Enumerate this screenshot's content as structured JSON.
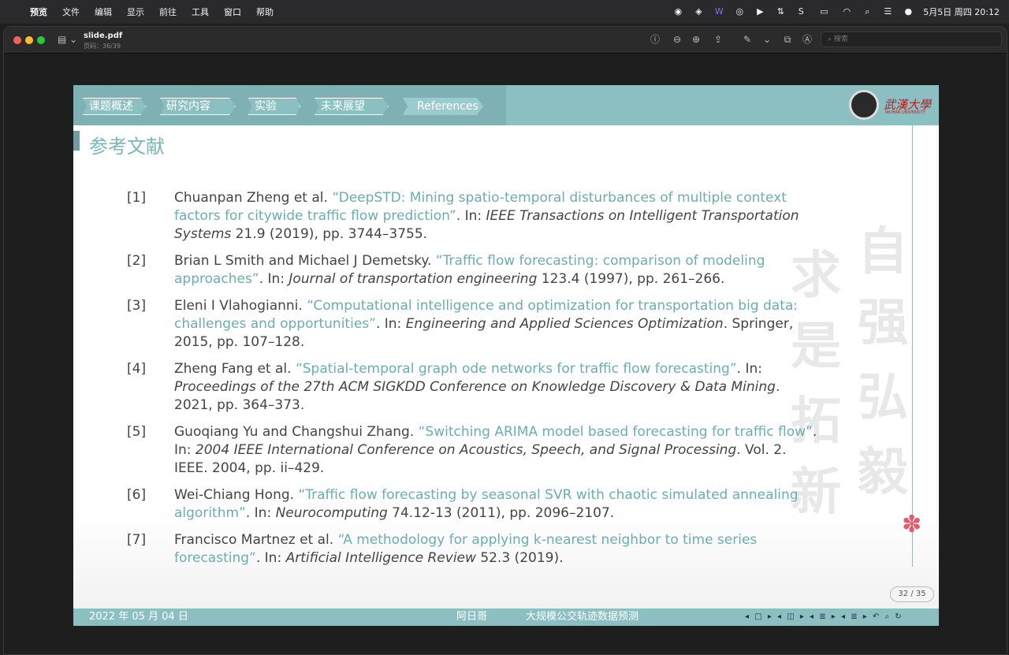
{
  "menubar": {
    "app": "预览",
    "items": [
      "文件",
      "编辑",
      "显示",
      "前往",
      "工具",
      "窗口",
      "帮助"
    ],
    "clock": "5月5日 周四  20:12"
  },
  "window": {
    "doc_title": "slide.pdf",
    "doc_subtitle": "页码：36/39",
    "search_placeholder": "搜索"
  },
  "slide": {
    "nav_tabs": [
      "课题概述",
      "研究内容",
      "实验",
      "未来展望",
      "References"
    ],
    "logo_text": "武漢大學",
    "logo_sub": "WUHAN UNIVERSITY",
    "title": "参考文献",
    "references": [
      {
        "num": "[1]",
        "authors": "Chuanpan Zheng et al. ",
        "title": "“DeepSTD: Mining spatio-temporal disturbances of multiple context factors for citywide traffic flow prediction”",
        "in": ". In: ",
        "venue": "IEEE Transactions on Intelligent Transportation Systems",
        "rest": " 21.9 (2019), pp. 3744–3755."
      },
      {
        "num": "[2]",
        "authors": "Brian L Smith and Michael J Demetsky. ",
        "title": "“Traffic flow forecasting: comparison of modeling approaches”",
        "in": ". In: ",
        "venue": "Journal of transportation engineering",
        "rest": " 123.4 (1997), pp. 261–266."
      },
      {
        "num": "[3]",
        "authors": "Eleni I Vlahogianni. ",
        "title": "“Computational intelligence and optimization for transportation big data: challenges and opportunities”",
        "in": ". In: ",
        "venue": "Engineering and Applied Sciences Optimization",
        "rest": ". Springer, 2015, pp. 107–128."
      },
      {
        "num": "[4]",
        "authors": "Zheng Fang et al. ",
        "title": "“Spatial-temporal graph ode networks for traffic flow forecasting”",
        "in": ". In: ",
        "venue": "Proceedings of the 27th ACM SIGKDD Conference on Knowledge Discovery & Data Mining",
        "rest": ". 2021, pp. 364–373."
      },
      {
        "num": "[5]",
        "authors": "Guoqiang Yu and Changshui Zhang. ",
        "title": "“Switching ARIMA model based forecasting for traffic flow”",
        "in": ". In: ",
        "venue": "2004 IEEE International Conference on Acoustics, Speech, and Signal Processing",
        "rest": ". Vol. 2. IEEE. 2004, pp. ii–429."
      },
      {
        "num": "[6]",
        "authors": "Wei-Chiang Hong. ",
        "title": "“Traffic flow forecasting by seasonal SVR with chaotic simulated annealing algorithm”",
        "in": ". In: ",
        "venue": "Neurocomputing",
        "rest": " 74.12-13 (2011), pp. 2096–2107."
      },
      {
        "num": "[7]",
        "authors": "Francisco Martnez et al. ",
        "title": "“A methodology for applying k-nearest neighbor to time series forecasting”",
        "in": ". In: ",
        "venue": "Artificial Intelligence Review",
        "rest": " 52.3 (2019)."
      }
    ],
    "calligraphy": [
      "自",
      "强",
      "弘",
      "毅",
      "求",
      "是",
      "拓",
      "新"
    ],
    "page_badge": "32 / 35",
    "footer": {
      "date": "2022 年 05 月 04 日",
      "author": "阿日哥",
      "title": "大规模公交轨迹数据预测",
      "nav_symbols": "◂ □ ▸ ◂ ◫ ▸ ◂ ≣ ▸ ◂ ≣ ▸ ↶ ⌕ ↻"
    }
  }
}
